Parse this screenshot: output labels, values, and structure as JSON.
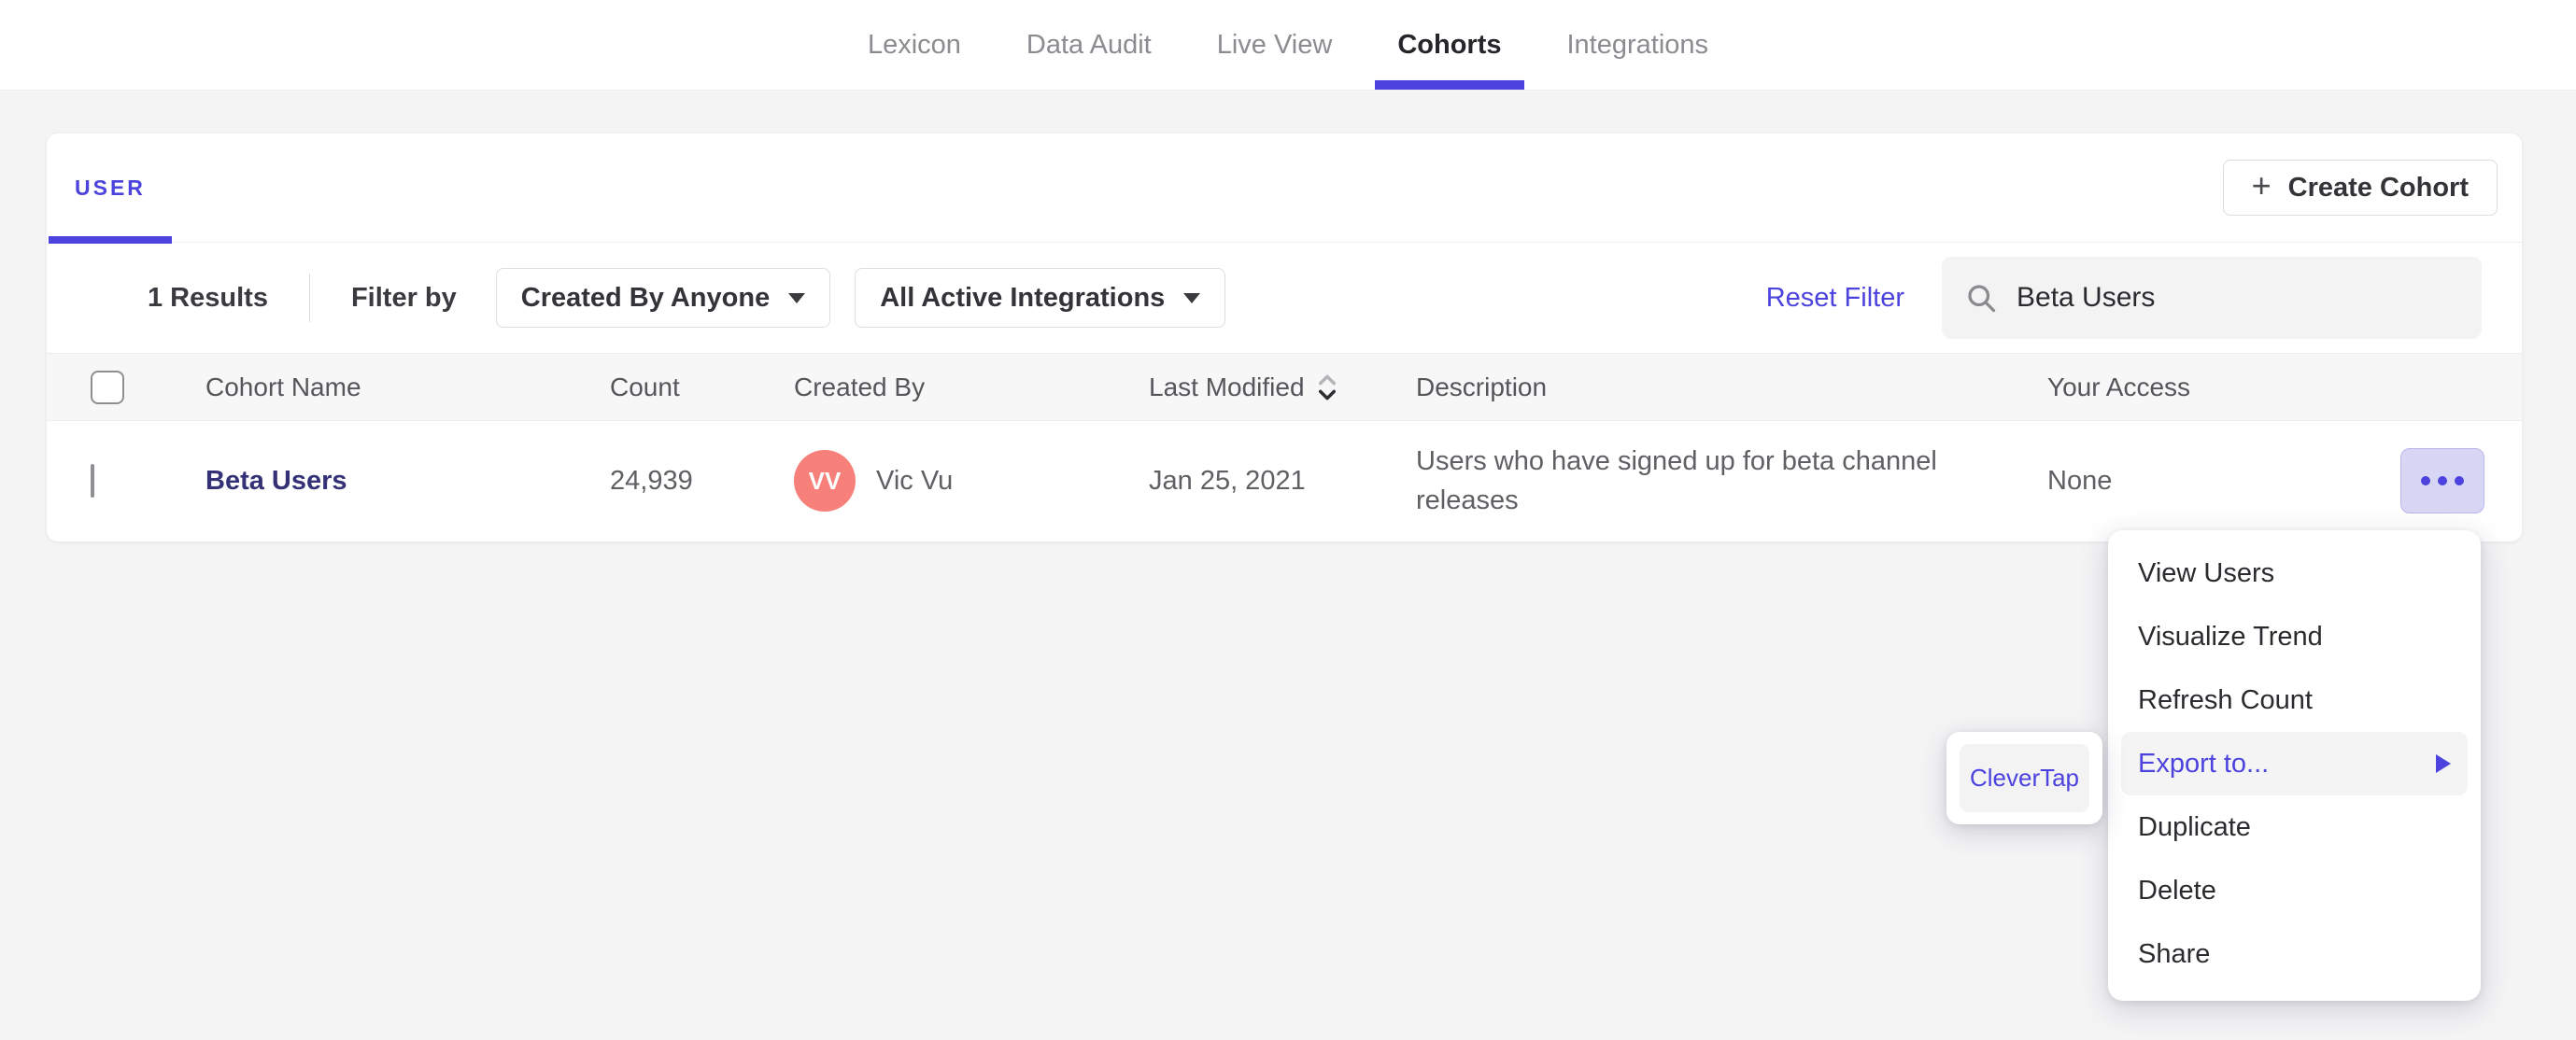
{
  "nav": {
    "tabs": [
      {
        "label": "Lexicon",
        "active": false
      },
      {
        "label": "Data Audit",
        "active": false
      },
      {
        "label": "Live View",
        "active": false
      },
      {
        "label": "Cohorts",
        "active": true
      },
      {
        "label": "Integrations",
        "active": false
      }
    ]
  },
  "cohorts_panel": {
    "tab_label": "USER",
    "create_cohort_button": "Create Cohort",
    "plus_glyph": "+",
    "filter_bar": {
      "results_text": "1 Results",
      "filter_by_label": "Filter by",
      "created_by_dropdown": "Created By Anyone",
      "integrations_dropdown": "All Active Integrations",
      "reset_filter_link": "Reset Filter",
      "search_value": "Beta Users"
    },
    "table": {
      "columns": [
        "Cohort Name",
        "Count",
        "Created By",
        "Last Modified",
        "Description",
        "Your Access"
      ],
      "sort": {
        "column": "Last Modified",
        "direction": "desc"
      },
      "rows": [
        {
          "name": "Beta Users",
          "count": "24,939",
          "avatar_initials": "VV",
          "created_by": "Vic Vu",
          "last_modified": "Jan 25, 2021",
          "description": "Users who have signed up for beta channel releases",
          "your_access": "None"
        }
      ]
    }
  },
  "context_menu": {
    "items": [
      {
        "label": "View Users",
        "highlighted": false
      },
      {
        "label": "Visualize Trend",
        "highlighted": false
      },
      {
        "label": "Refresh Count",
        "highlighted": false
      },
      {
        "label": "Export to...",
        "highlighted": true,
        "has_submenu": true
      },
      {
        "label": "Duplicate",
        "highlighted": false
      },
      {
        "label": "Delete",
        "highlighted": false
      },
      {
        "label": "Share",
        "highlighted": false
      }
    ],
    "export_submenu": {
      "items": [
        {
          "label": "CleverTap"
        }
      ]
    }
  },
  "colors": {
    "accent": "#4c43de",
    "cohort_link": "#343176",
    "avatar_bg": "#f7807a",
    "menu_highlight_bg": "#f4f4f5"
  }
}
